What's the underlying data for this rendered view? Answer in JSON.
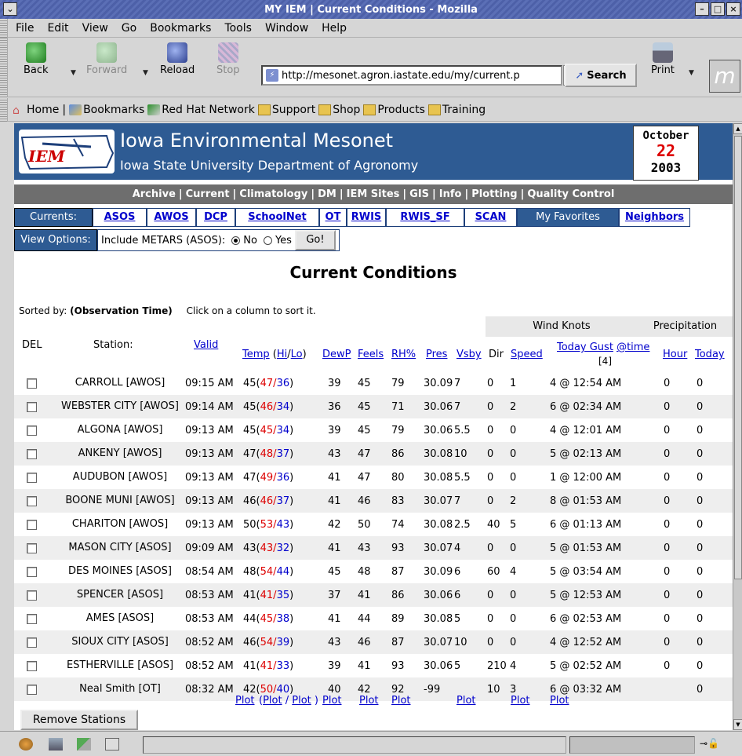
{
  "window": {
    "title": "MY IEM | Current Conditions - Mozilla"
  },
  "menu": [
    "File",
    "Edit",
    "View",
    "Go",
    "Bookmarks",
    "Tools",
    "Window",
    "Help"
  ],
  "nav": {
    "back": "Back",
    "forward": "Forward",
    "reload": "Reload",
    "stop": "Stop",
    "url": "http://mesonet.agron.iastate.edu/my/current.p",
    "search": "Search",
    "print": "Print"
  },
  "personal": [
    "Home",
    "Bookmarks",
    "Red Hat Network",
    "Support",
    "Shop",
    "Products",
    "Training"
  ],
  "header": {
    "title": "Iowa Environmental Mesonet",
    "subtitle": "Iowa State University Department of Agronomy",
    "logo": "IEM",
    "date_month": "October",
    "date_day": "22",
    "date_year": "2003"
  },
  "sitenav": [
    "Archive",
    "Current",
    "Climatology",
    "DM",
    "IEM Sites",
    "GIS",
    "Info",
    "Plotting",
    "Quality Control"
  ],
  "currents": {
    "label": "Currents:",
    "items": [
      "ASOS",
      "AWOS",
      "DCP",
      "SchoolNet",
      "OT",
      "RWIS",
      "RWIS_SF",
      "SCAN",
      "My Favorites",
      "Neighbors"
    ],
    "selected": "My Favorites"
  },
  "view_options": {
    "label": "View Options:",
    "text": "Include METARS (ASOS):",
    "no": "No",
    "yes": "Yes",
    "go": "Go!"
  },
  "page": {
    "title": "Current Conditions",
    "sorted_label": "Sorted by:",
    "sorted_value": "(Observation Time)",
    "sort_hint": "Click on a column to sort it."
  },
  "groups": {
    "wind": "Wind Knots",
    "precip": "Precipitation"
  },
  "columns": {
    "del": "DEL",
    "station": "Station:",
    "valid": "Valid",
    "temp": "Temp",
    "hi": "Hi",
    "lo": "Lo",
    "dewp": "DewP",
    "feels": "Feels",
    "rh": "RH%",
    "pres": "Pres",
    "vsby": "Vsby",
    "dir": "Dir",
    "speed": "Speed",
    "gust": "Today Gust",
    "time": "@time",
    "note": "[4]",
    "hour": "Hour",
    "today": "Today"
  },
  "rows": [
    {
      "station": "CARROLL [AWOS]",
      "valid": "09:15 AM",
      "temp": "45",
      "hi": "47",
      "lo": "36",
      "dewp": "39",
      "feels": "45",
      "rh": "79",
      "pres": "30.09",
      "vsby": "7",
      "dir": "0",
      "speed": "1",
      "gust": "4 @ 12:54 AM",
      "hour": "0",
      "today": "0"
    },
    {
      "station": "WEBSTER CITY [AWOS]",
      "valid": "09:14 AM",
      "temp": "45",
      "hi": "46",
      "lo": "34",
      "dewp": "36",
      "feels": "45",
      "rh": "71",
      "pres": "30.06",
      "vsby": "7",
      "dir": "0",
      "speed": "2",
      "gust": "6 @ 02:34 AM",
      "hour": "0",
      "today": "0"
    },
    {
      "station": "ALGONA [AWOS]",
      "valid": "09:13 AM",
      "temp": "45",
      "hi": "45",
      "lo": "34",
      "dewp": "39",
      "feels": "45",
      "rh": "79",
      "pres": "30.06",
      "vsby": "5.5",
      "dir": "0",
      "speed": "0",
      "gust": "4 @ 12:01 AM",
      "hour": "0",
      "today": "0"
    },
    {
      "station": "ANKENY [AWOS]",
      "valid": "09:13 AM",
      "temp": "47",
      "hi": "48",
      "lo": "37",
      "dewp": "43",
      "feels": "47",
      "rh": "86",
      "pres": "30.08",
      "vsby": "10",
      "dir": "0",
      "speed": "0",
      "gust": "5 @ 02:13 AM",
      "hour": "0",
      "today": "0"
    },
    {
      "station": "AUDUBON [AWOS]",
      "valid": "09:13 AM",
      "temp": "47",
      "hi": "49",
      "lo": "36",
      "dewp": "41",
      "feels": "47",
      "rh": "80",
      "pres": "30.08",
      "vsby": "5.5",
      "dir": "0",
      "speed": "0",
      "gust": "1 @ 12:00 AM",
      "hour": "0",
      "today": "0"
    },
    {
      "station": "BOONE MUNI [AWOS]",
      "valid": "09:13 AM",
      "temp": "46",
      "hi": "46",
      "lo": "37",
      "dewp": "41",
      "feels": "46",
      "rh": "83",
      "pres": "30.07",
      "vsby": "7",
      "dir": "0",
      "speed": "2",
      "gust": "8 @ 01:53 AM",
      "hour": "0",
      "today": "0"
    },
    {
      "station": "CHARITON [AWOS]",
      "valid": "09:13 AM",
      "temp": "50",
      "hi": "53",
      "lo": "43",
      "dewp": "42",
      "feels": "50",
      "rh": "74",
      "pres": "30.08",
      "vsby": "2.5",
      "dir": "40",
      "speed": "5",
      "gust": "6 @ 01:13 AM",
      "hour": "0",
      "today": "0"
    },
    {
      "station": "MASON CITY [ASOS]",
      "valid": "09:09 AM",
      "temp": "43",
      "hi": "43",
      "lo": "32",
      "dewp": "41",
      "feels": "43",
      "rh": "93",
      "pres": "30.07",
      "vsby": "4",
      "dir": "0",
      "speed": "0",
      "gust": "5 @ 01:53 AM",
      "hour": "0",
      "today": "0"
    },
    {
      "station": "DES MOINES [ASOS]",
      "valid": "08:54 AM",
      "temp": "48",
      "hi": "54",
      "lo": "44",
      "dewp": "45",
      "feels": "48",
      "rh": "87",
      "pres": "30.09",
      "vsby": "6",
      "dir": "60",
      "speed": "4",
      "gust": "5 @ 03:54 AM",
      "hour": "0",
      "today": "0"
    },
    {
      "station": "SPENCER [ASOS]",
      "valid": "08:53 AM",
      "temp": "41",
      "hi": "41",
      "lo": "35",
      "dewp": "37",
      "feels": "41",
      "rh": "86",
      "pres": "30.06",
      "vsby": "6",
      "dir": "0",
      "speed": "0",
      "gust": "5 @ 12:53 AM",
      "hour": "0",
      "today": "0"
    },
    {
      "station": "AMES [ASOS]",
      "valid": "08:53 AM",
      "temp": "44",
      "hi": "45",
      "lo": "38",
      "dewp": "41",
      "feels": "44",
      "rh": "89",
      "pres": "30.08",
      "vsby": "5",
      "dir": "0",
      "speed": "0",
      "gust": "6 @ 02:53 AM",
      "hour": "0",
      "today": "0"
    },
    {
      "station": "SIOUX CITY [ASOS]",
      "valid": "08:52 AM",
      "temp": "46",
      "hi": "54",
      "lo": "39",
      "dewp": "43",
      "feels": "46",
      "rh": "87",
      "pres": "30.07",
      "vsby": "10",
      "dir": "0",
      "speed": "0",
      "gust": "4 @ 12:52 AM",
      "hour": "0",
      "today": "0"
    },
    {
      "station": "ESTHERVILLE [ASOS]",
      "valid": "08:52 AM",
      "temp": "41",
      "hi": "41",
      "lo": "33",
      "dewp": "39",
      "feels": "41",
      "rh": "93",
      "pres": "30.06",
      "vsby": "5",
      "dir": "210",
      "speed": "4",
      "gust": "5 @ 02:52 AM",
      "hour": "0",
      "today": "0"
    },
    {
      "station": "Neal Smith [OT]",
      "valid": "08:32 AM",
      "temp": "42",
      "hi": "50",
      "lo": "40",
      "dewp": "40",
      "feels": "42",
      "rh": "92",
      "pres": "-99",
      "vsby": "",
      "dir": "10",
      "speed": "3",
      "gust": "6 @ 03:32 AM",
      "hour": "",
      "today": "0"
    }
  ],
  "plot": "Plot",
  "remove_button": "Remove Stations",
  "colors": {
    "header_blue": "#2e5b93",
    "nav_gray": "#6e6e6e",
    "hi_red": "#dd0000",
    "lo_blue": "#0000cc"
  }
}
